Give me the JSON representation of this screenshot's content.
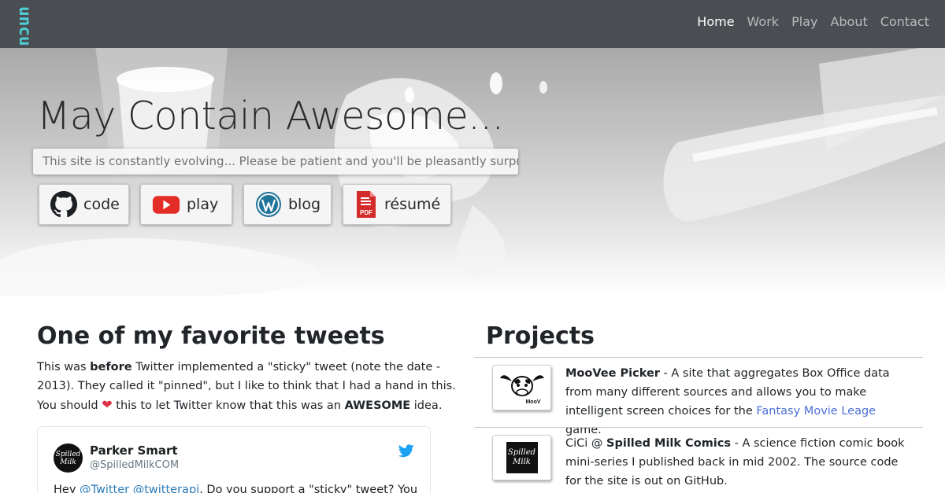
{
  "navbar": {
    "logo": "uncu",
    "items": [
      {
        "label": "Home",
        "active": true
      },
      {
        "label": "Work",
        "active": false
      },
      {
        "label": "Play",
        "active": false
      },
      {
        "label": "About",
        "active": false
      },
      {
        "label": "Contact",
        "active": false
      }
    ]
  },
  "hero": {
    "title": "May Contain Awesome...",
    "subtitle": "This site is constantly evolving... Please be patient and you'll be pleasantly surprised.",
    "buttons": [
      {
        "label": "code",
        "icon": "github-icon"
      },
      {
        "label": "play",
        "icon": "youtube-icon"
      },
      {
        "label": "blog",
        "icon": "wordpress-icon"
      },
      {
        "label": "résumé",
        "icon": "pdf-icon",
        "icon_text": "PDF"
      }
    ]
  },
  "tweets": {
    "heading": "One of my favorite tweets",
    "intro": {
      "p1": "This was ",
      "b1": "before",
      "p2": " Twitter implemented a \"sticky\" tweet (note the date - 2013). They called it \"pinned\", but I like to think that I had a hand in this. You should ",
      "p3": " this to let Twitter know that this was an ",
      "b2": "AWESOME",
      "p4": " idea."
    },
    "card": {
      "avatar_text": "Spilled Milk",
      "name": "Parker Smart",
      "handle": "@SpilledMilkCOM",
      "text_prefix": "Hey ",
      "mention1": "@Twitter",
      "mention2": "@twitterapi",
      "text_rest": ". Do you support a \"sticky\" tweet?  You"
    }
  },
  "projects": {
    "heading": "Projects",
    "items": [
      {
        "thumb_text": "MooV",
        "name": "MooVee Picker",
        "desc_a": " - A site that aggregates Box Office data from many different sources and allows you to make intelligent screen choices for the ",
        "link": "Fantasy Movie Leage",
        "desc_b": " game."
      },
      {
        "thumb_text": "Spilled Milk",
        "prefix": "CiCi @ ",
        "name": "Spilled Milk Comics",
        "desc_a": " - A science fiction comic book mini-series I published back in mid 2002. The source code for the site is out on GitHub."
      }
    ]
  },
  "colors": {
    "navbar_bg": "#4a4d52",
    "logo": "#4fd0d6",
    "link": "#4a6fd6",
    "twitter_blue": "#1da1f2",
    "youtube_red": "#e52d27",
    "wordpress_blue": "#21759b",
    "pdf_red": "#d42b2b"
  }
}
